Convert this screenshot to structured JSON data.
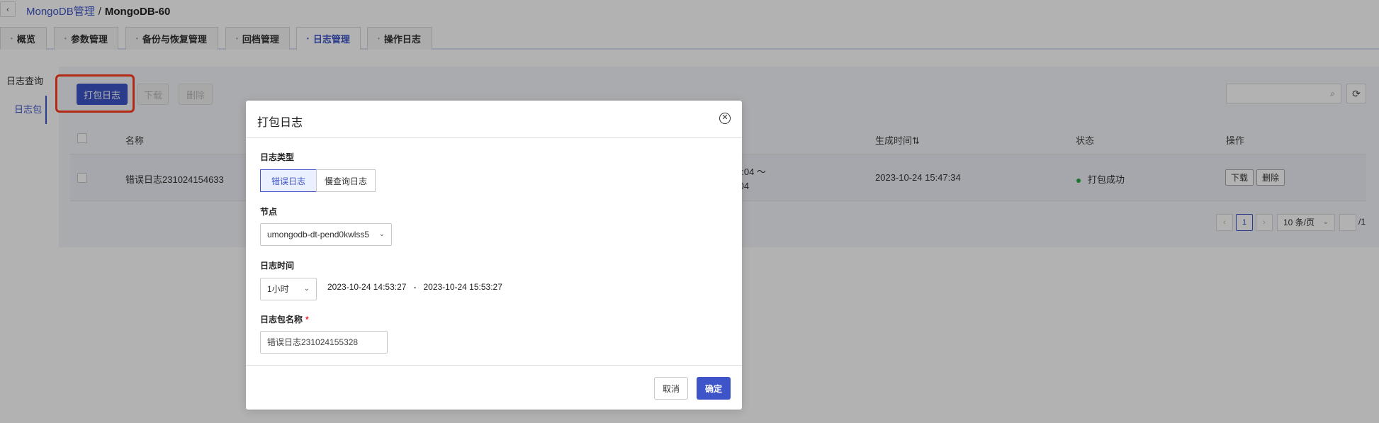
{
  "breadcrumb": {
    "back_icon": "‹",
    "parent": "MongoDB管理",
    "separator": "/",
    "current": "MongoDB-60"
  },
  "tabs": [
    {
      "label": "概览",
      "active": false
    },
    {
      "label": "参数管理",
      "active": false
    },
    {
      "label": "备份与恢复管理",
      "active": false
    },
    {
      "label": "回档管理",
      "active": false
    },
    {
      "label": "日志管理",
      "active": true
    },
    {
      "label": "操作日志",
      "active": false
    }
  ],
  "sidenav": [
    {
      "label": "日志查询",
      "active": false
    },
    {
      "label": "日志包",
      "active": true
    }
  ],
  "toolbar": {
    "pack_label": "打包日志",
    "download_label": "下载",
    "delete_label": "删除",
    "search_placeholder": "",
    "search_icon": "⌕",
    "refresh_icon": "⟳"
  },
  "table": {
    "columns": [
      "名称",
      "生成时间⇅",
      "状态",
      "操作"
    ],
    "rows": [
      {
        "name": "错误日志231024154633",
        "time_range_line1": "4:04 ～",
        "time_range_line2": ":04",
        "created": "2023-10-24 15:47:34",
        "status": "打包成功",
        "actions": [
          "下载",
          "删除"
        ]
      }
    ]
  },
  "pagination": {
    "prev": "‹",
    "current": "1",
    "next": "›",
    "page_size": "10 条/页",
    "page_size_chevron": "⌄",
    "jump_value": "",
    "total": "/1"
  },
  "modal": {
    "title": "打包日志",
    "close_icon": "✕",
    "log_type_label": "日志类型",
    "log_type_options": [
      {
        "label": "错误日志",
        "selected": true
      },
      {
        "label": "慢查询日志",
        "selected": false
      }
    ],
    "node_label": "节点",
    "node_value": "umongodb-dt-pend0kwlss5",
    "node_chevron": "⌄",
    "time_label": "日志时间",
    "time_range_select": "1小时",
    "time_start": "2023-10-24 14:53:27",
    "time_dash": "-",
    "time_end": "2023-10-24 15:53:27",
    "name_label": "日志包名称",
    "required_mark": "*",
    "name_value": "错误日志231024155328",
    "cancel_label": "取消",
    "ok_label": "确定"
  },
  "colors": {
    "primary": "#3d55c8",
    "highlight": "#ff3b1f",
    "success": "#27a844"
  }
}
